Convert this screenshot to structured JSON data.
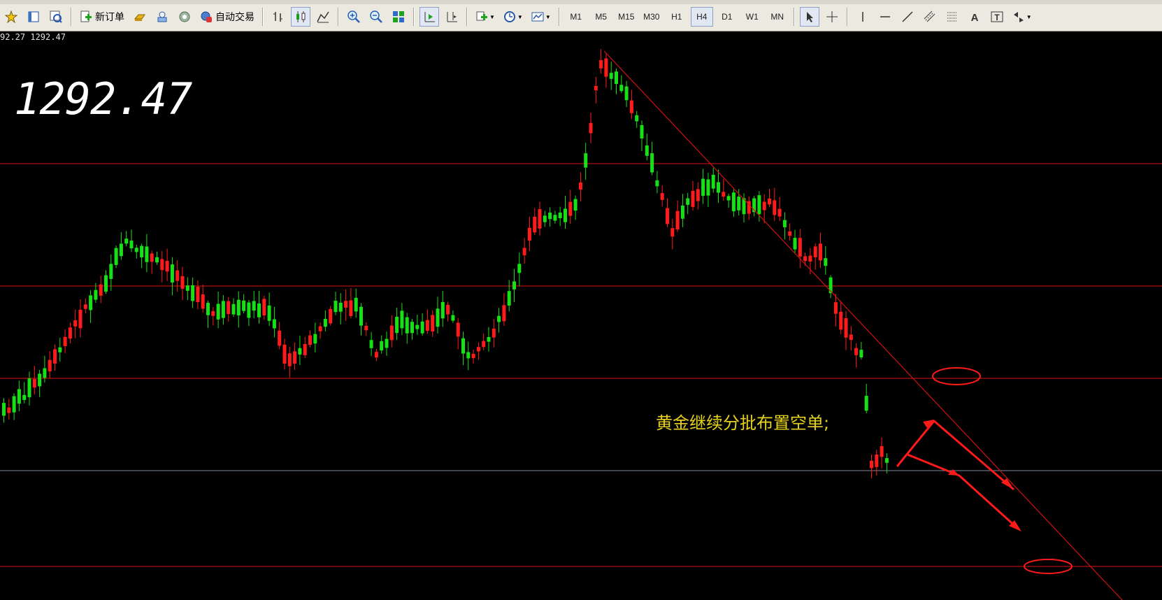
{
  "toolbar": {
    "new_order_label": "新订单",
    "auto_trade_label": "自动交易",
    "timeframes": [
      "M1",
      "M5",
      "M15",
      "M30",
      "H1",
      "H4",
      "D1",
      "W1",
      "MN"
    ],
    "active_timeframe": "H4"
  },
  "chart": {
    "header_prices": "92.27 1292.47",
    "current_price": "1292.47",
    "annotation": "黄金继续分批布置空单;",
    "colors": {
      "bull": "#ff1b1b",
      "bear": "#16e016",
      "hline": "#e01515",
      "trend": "#d01212",
      "arrow": "#ff1a1a",
      "price_line": "#7e8a96"
    }
  }
}
